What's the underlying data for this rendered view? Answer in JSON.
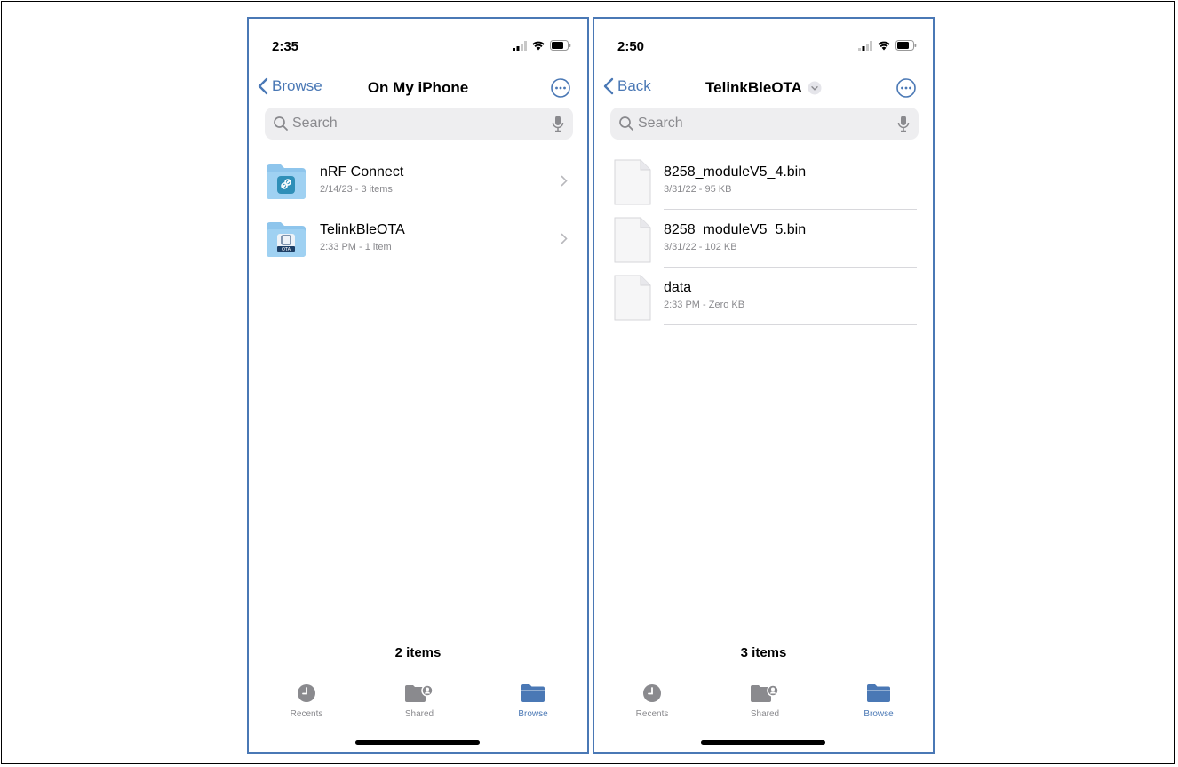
{
  "screens": [
    {
      "status_time": "2:35",
      "back_label": "Browse",
      "title": "On My iPhone",
      "search_placeholder": "Search",
      "items": [
        {
          "name": "nRF Connect",
          "meta": "2/14/23 - 3 items",
          "icon": "nrf-connect-folder-icon"
        },
        {
          "name": "TelinkBleOTA",
          "meta": "2:33 PM - 1 item",
          "icon": "telink-ota-folder-icon",
          "badge": "OTA"
        }
      ],
      "count": "2 items",
      "tabs": [
        "Recents",
        "Shared",
        "Browse"
      ]
    },
    {
      "status_time": "2:50",
      "back_label": "Back",
      "title": "TelinkBleOTA",
      "search_placeholder": "Search",
      "items": [
        {
          "name": "8258_moduleV5_4.bin",
          "meta": "3/31/22 - 95 KB",
          "icon": "document-icon"
        },
        {
          "name": "8258_moduleV5_5.bin",
          "meta": "3/31/22 - 102 KB",
          "icon": "document-icon"
        },
        {
          "name": "data",
          "meta": "2:33 PM - Zero KB",
          "icon": "document-icon"
        }
      ],
      "count": "3 items",
      "tabs": [
        "Recents",
        "Shared",
        "Browse"
      ]
    }
  ],
  "colors": {
    "accent": "#4a78b5",
    "folder": "#8ec5ec",
    "search_bg": "#eeeef0",
    "secondary_text": "#8a8a8e"
  },
  "active_tab": "Browse"
}
